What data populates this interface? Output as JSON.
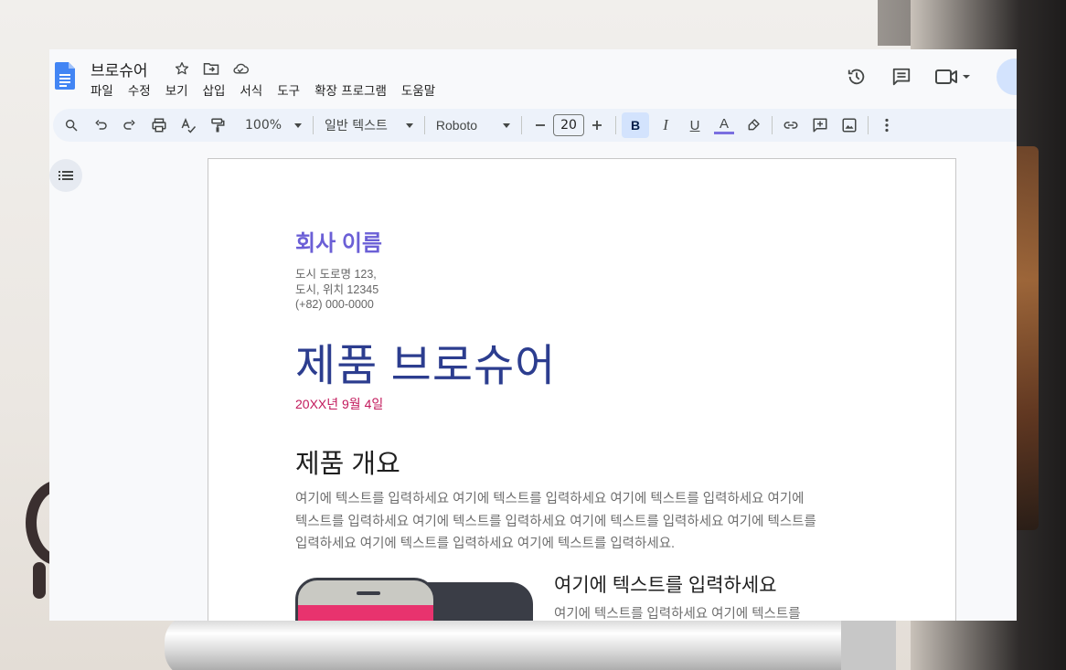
{
  "app": {
    "doc_title": "브로슈어",
    "menu": [
      "파일",
      "수정",
      "보기",
      "삽입",
      "서식",
      "도구",
      "확장 프로그램",
      "도움말"
    ]
  },
  "toolbar": {
    "zoom": "100%",
    "style": "일반 텍스트",
    "font": "Roboto",
    "font_size": "20",
    "bold_label": "B",
    "italic_label": "I",
    "underline_label": "U",
    "text_color_label": "A",
    "accent_color": "#7a6fe0"
  },
  "document": {
    "company_name": "회사 이름",
    "address_line1": "도시 도로명 123,",
    "address_line2": "도시, 위치 12345",
    "phone": "(+82) 000-0000",
    "title": "제품 브로슈어",
    "date": "20XX년 9월 4일",
    "section_heading": "제품 개요",
    "section_body_1": "여기에 텍스트를 입력하세요 여기에 텍스트를 입력하세요 여기에 텍스트를 입력하세요 여기에",
    "section_body_2": "텍스트를 입력하세요 여기에 텍스트를 입력하세요 여기에 텍스트를 입력하세요 여기에 텍스트를",
    "section_body_3": "입력하세요 여기에 텍스트를 입력하세요 여기에 텍스트를 입력하세요.",
    "sub_heading": "여기에 텍스트를 입력하세요",
    "sub_body": "여기에 텍스트를 입력하세요 여기에 텍스트를"
  },
  "icons": {
    "star": "star-icon",
    "move": "move-to-folder-icon",
    "cloud": "cloud-saved-icon",
    "history": "version-history-icon",
    "comment": "comments-icon",
    "meet": "meet-video-icon"
  },
  "colors": {
    "company": "#6b5fd6",
    "title": "#2c3d8f",
    "date": "#c2185b",
    "phone_screen": "#e8336e"
  }
}
